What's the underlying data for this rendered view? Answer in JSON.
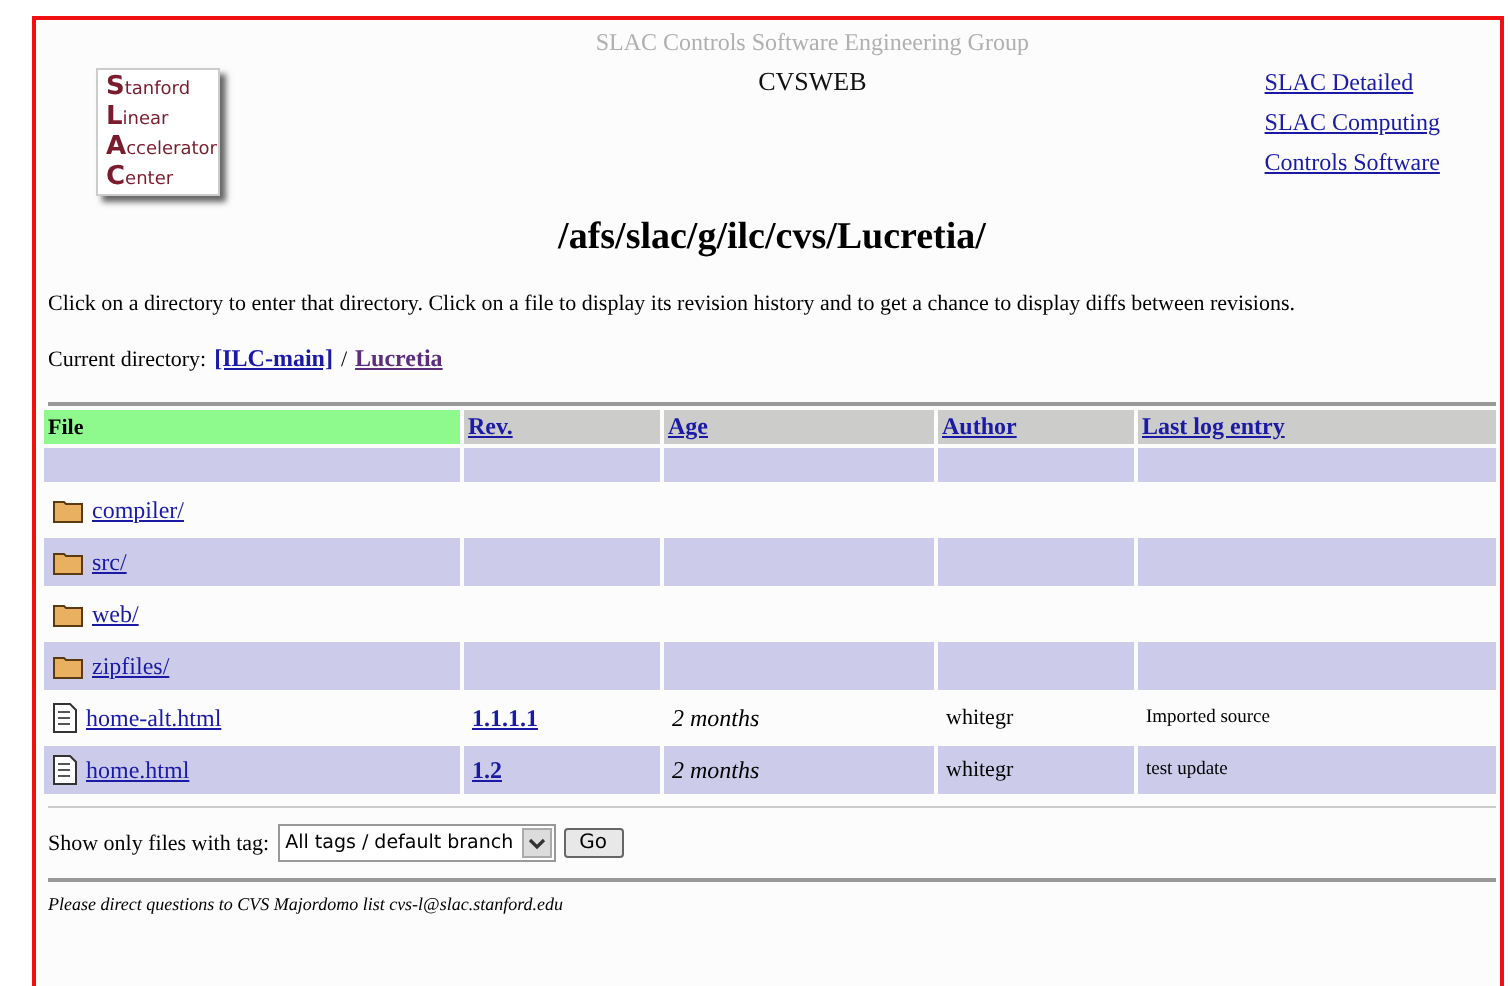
{
  "header": {
    "group": "SLAC Controls Software Engineering Group",
    "title": "CVSWEB",
    "logo_lines": [
      "Stanford",
      "Linear",
      "Accelerator",
      "Center"
    ],
    "links": [
      "SLAC Detailed",
      "SLAC Computing",
      "Controls Software"
    ]
  },
  "path_title": "/afs/slac/g/ilc/cvs/Lucretia/",
  "instructions": "Click on a directory to enter that directory. Click on a file to display its revision history and to get a chance to display diffs between revisions.",
  "current_directory": {
    "label": "Current directory:",
    "root": "[ILC-main]",
    "separator": "/",
    "current": "Lucretia"
  },
  "table": {
    "columns": [
      {
        "label": "File",
        "selected": true
      },
      {
        "label": "Rev.",
        "selected": false
      },
      {
        "label": "Age",
        "selected": false
      },
      {
        "label": "Author",
        "selected": false
      },
      {
        "label": "Last log entry",
        "selected": false
      }
    ],
    "rows": [
      {
        "kind": "dir",
        "name": "compiler/"
      },
      {
        "kind": "dir",
        "name": "src/"
      },
      {
        "kind": "dir",
        "name": "web/"
      },
      {
        "kind": "dir",
        "name": "zipfiles/"
      },
      {
        "kind": "file",
        "name": "home-alt.html",
        "rev": "1.1.1.1",
        "age": "2 months",
        "author": "whitegr",
        "log": "Imported source"
      },
      {
        "kind": "file",
        "name": "home.html",
        "rev": "1.2",
        "age": "2 months",
        "author": "whitegr",
        "log": "test update"
      }
    ]
  },
  "tag_filter": {
    "label": "Show only files with tag:",
    "value": "All tags / default branch",
    "button": "Go"
  },
  "footer": "Please direct questions to CVS Majordomo list cvs-l@slac.stanford.edu"
}
